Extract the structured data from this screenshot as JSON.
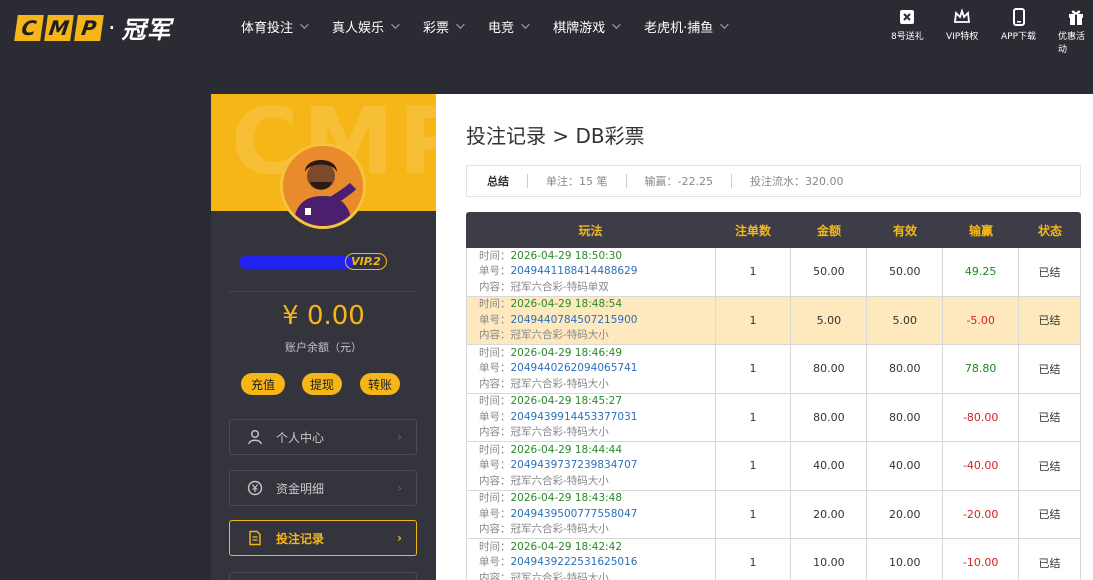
{
  "brand": {
    "letters": [
      "C",
      "M",
      "P"
    ],
    "dot": "·",
    "name": "冠军"
  },
  "nav": [
    {
      "label": "体育投注"
    },
    {
      "label": "真人娱乐"
    },
    {
      "label": "彩票"
    },
    {
      "label": "电竞"
    },
    {
      "label": "棋牌游戏"
    },
    {
      "label": "老虎机·捕鱼"
    }
  ],
  "quick_links": [
    {
      "label": "8号送礼",
      "icon": "gift-box-icon"
    },
    {
      "label": "VIP特权",
      "icon": "crown-icon"
    },
    {
      "label": "APP下载",
      "icon": "phone-icon"
    },
    {
      "label": "优惠活动",
      "icon": "present-icon"
    }
  ],
  "sidebar": {
    "banner_watermark": "CMP",
    "vip_badge": "VIP.2",
    "balance": "¥ 0.00",
    "balance_label": "账户余额（元）",
    "actions": [
      "充值",
      "提现",
      "转账"
    ],
    "menu": [
      {
        "label": "个人中心",
        "icon": "user-icon",
        "arrow": "›",
        "active": false
      },
      {
        "label": "资金明细",
        "icon": "yuan-circle-icon",
        "arrow": "›",
        "active": false
      },
      {
        "label": "投注记录",
        "icon": "document-icon",
        "arrow": "›",
        "active": true
      }
    ]
  },
  "page": {
    "title": "投注记录 > DB彩票",
    "summary": {
      "lead": "总结",
      "bets": "单注：15 笔",
      "winloss": "输赢：-22.25",
      "turnover": "投注流水：320.00"
    }
  },
  "table": {
    "headers": [
      "玩法",
      "注单数",
      "金额",
      "有效",
      "输赢",
      "状态"
    ],
    "labels": {
      "time": "时间：",
      "order": "单号：",
      "content": "内容："
    },
    "rows": [
      {
        "time": "2026-04-29 18:50:30",
        "order": "2049441188414488629",
        "content": "冠军六合彩-特码单双",
        "count": "1",
        "amount": "50.00",
        "valid": "50.00",
        "winloss": "49.25",
        "status": "已结",
        "highlight": false
      },
      {
        "time": "2026-04-29 18:48:54",
        "order": "2049440784507215900",
        "content": "冠军六合彩-特码大小",
        "count": "1",
        "amount": "5.00",
        "valid": "5.00",
        "winloss": "-5.00",
        "status": "已结",
        "highlight": true
      },
      {
        "time": "2026-04-29 18:46:49",
        "order": "2049440262094065741",
        "content": "冠军六合彩-特码大小",
        "count": "1",
        "amount": "80.00",
        "valid": "80.00",
        "winloss": "78.80",
        "status": "已结",
        "highlight": false
      },
      {
        "time": "2026-04-29 18:45:27",
        "order": "2049439914453377031",
        "content": "冠军六合彩-特码大小",
        "count": "1",
        "amount": "80.00",
        "valid": "80.00",
        "winloss": "-80.00",
        "status": "已结",
        "highlight": false
      },
      {
        "time": "2026-04-29 18:44:44",
        "order": "2049439737239834707",
        "content": "冠军六合彩-特码大小",
        "count": "1",
        "amount": "40.00",
        "valid": "40.00",
        "winloss": "-40.00",
        "status": "已结",
        "highlight": false
      },
      {
        "time": "2026-04-29 18:43:48",
        "order": "2049439500777558047",
        "content": "冠军六合彩-特码大小",
        "count": "1",
        "amount": "20.00",
        "valid": "20.00",
        "winloss": "-20.00",
        "status": "已结",
        "highlight": false
      },
      {
        "time": "2026-04-29 18:42:42",
        "order": "2049439222531625016",
        "content": "冠军六合彩-特码大小",
        "count": "1",
        "amount": "10.00",
        "valid": "10.00",
        "winloss": "-10.00",
        "status": "已结",
        "highlight": false
      }
    ]
  },
  "colors": {
    "accent": "#f6b618",
    "background": "#2b2b33",
    "win": "#1b8a1b",
    "loss": "#d62222",
    "highlight_row": "#fde9bd"
  }
}
